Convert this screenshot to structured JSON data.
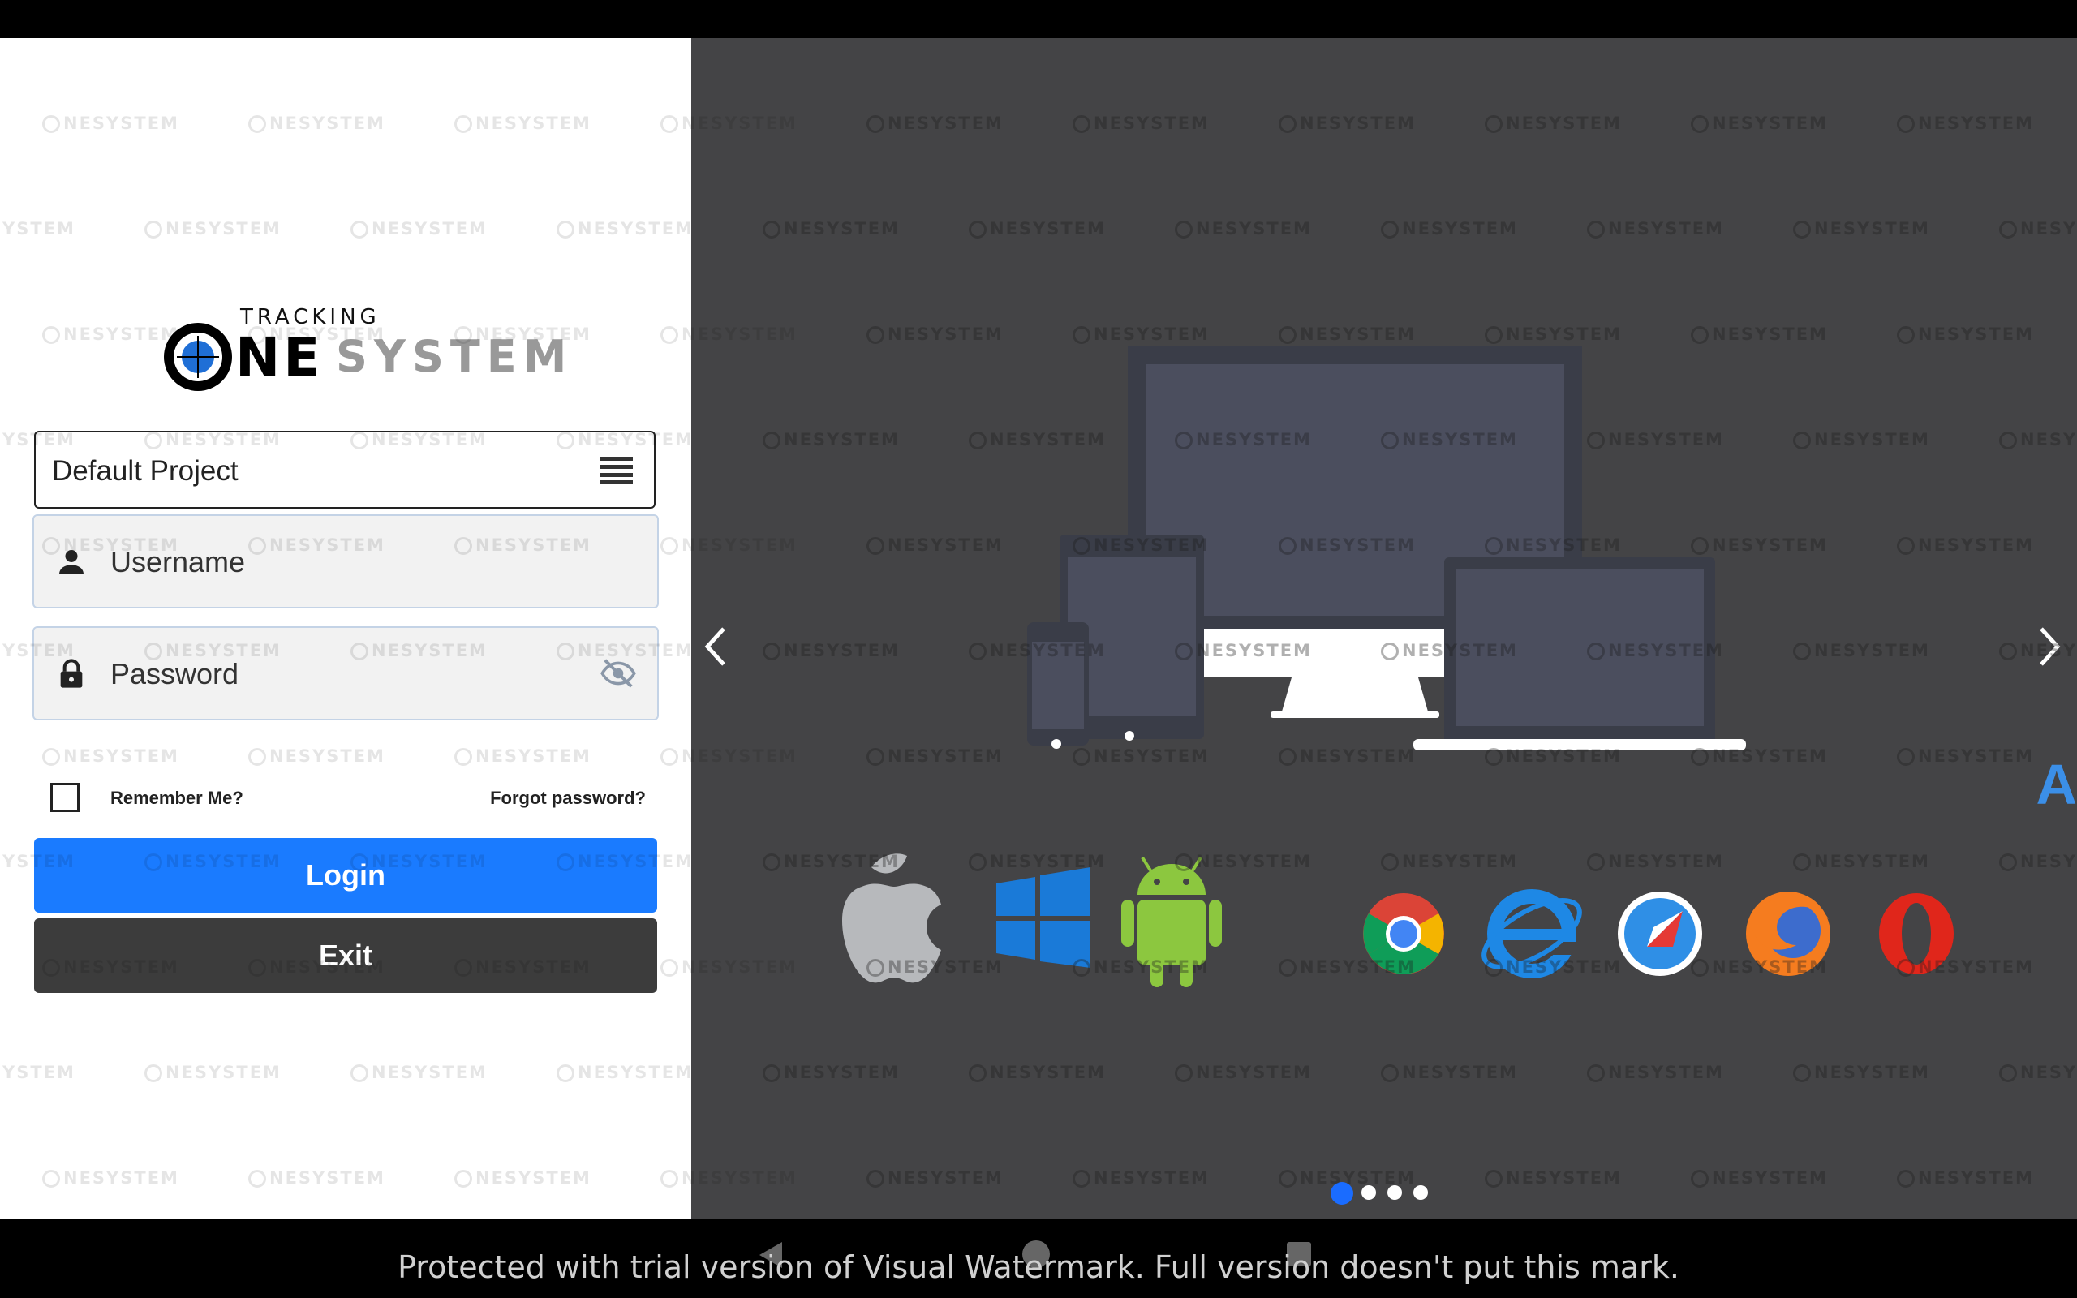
{
  "logo": {
    "tracking": "TRACKING",
    "ne": "NE",
    "system": "SYSTEM"
  },
  "project": {
    "label": "Default Project",
    "icon": "menu-icon"
  },
  "login": {
    "username_placeholder": "Username",
    "password_placeholder": "Password",
    "username_icon": "person-icon",
    "password_icon": "lock-icon",
    "toggle_icon": "eye-off-icon",
    "remember_label": "Remember Me?",
    "forgot_label": "Forgot password?",
    "login_label": "Login",
    "exit_label": "Exit"
  },
  "carousel": {
    "slide_count": 4,
    "active_slide": 1,
    "os_icons": [
      "apple-icon",
      "windows-icon",
      "android-icon"
    ],
    "browser_icons": [
      "chrome-icon",
      "internet-explorer-icon",
      "safari-icon",
      "firefox-icon",
      "opera-icon"
    ],
    "edge_glyph": "A"
  },
  "watermark": {
    "banner": "Protected with trial version of Visual Watermark. Full version doesn't put this mark.",
    "tile_text": "NESYSTEM"
  },
  "colors": {
    "primary": "#1a7bff",
    "exit": "#3c3c3c",
    "carousel_bg": "#444446",
    "dot_active": "#1a6cff"
  }
}
